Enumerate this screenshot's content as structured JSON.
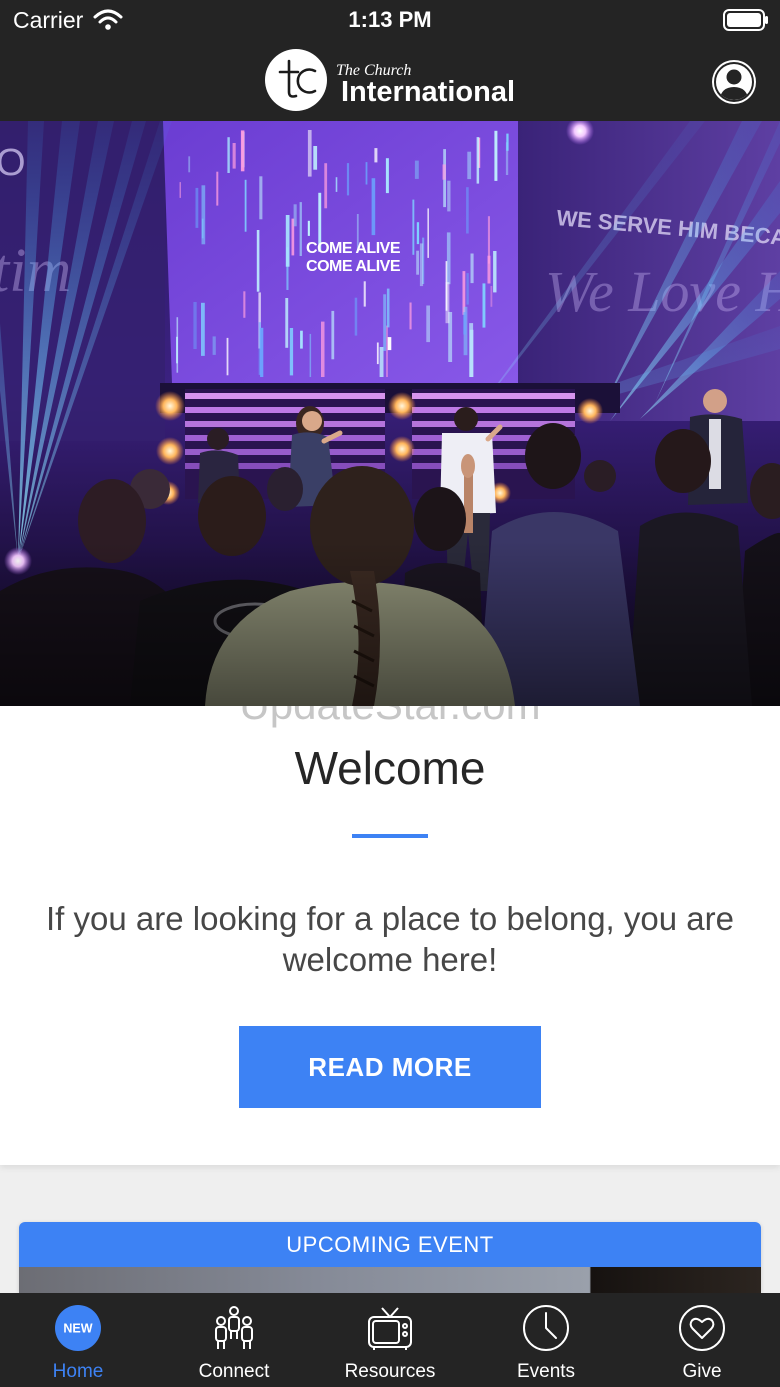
{
  "status_bar": {
    "carrier": "Carrier",
    "time": "1:13 PM",
    "wifi_icon": "wifi-icon",
    "battery_icon": "battery-icon"
  },
  "header": {
    "logo_mark": "tC",
    "logo_line1": "The Church",
    "logo_line2": "International",
    "profile_icon": "user-profile-icon"
  },
  "hero": {
    "screen_lines": [
      "COME ALIVE",
      "COME ALIVE"
    ],
    "wall_text": "WE SERVE HIM BECA",
    "wall_script": "We Love H",
    "left_script": "tim",
    "left_letter": "O"
  },
  "watermark": "UpdateStar.com",
  "welcome": {
    "title": "Welcome",
    "message": "If you are looking for a place to belong, you are welcome here!",
    "button_label": "READ MORE"
  },
  "upcoming_event": {
    "header": "UPCOMING EVENT"
  },
  "tabs": [
    {
      "label": "Home",
      "icon": "home-new-badge-icon",
      "badge": "NEW",
      "active": true
    },
    {
      "label": "Connect",
      "icon": "people-icon",
      "active": false
    },
    {
      "label": "Resources",
      "icon": "tv-icon",
      "active": false
    },
    {
      "label": "Events",
      "icon": "clock-icon",
      "active": false
    },
    {
      "label": "Give",
      "icon": "heart-circle-icon",
      "active": false
    }
  ],
  "colors": {
    "accent": "#3d82f4",
    "bar_background": "#242424",
    "page_background": "#efefef"
  }
}
